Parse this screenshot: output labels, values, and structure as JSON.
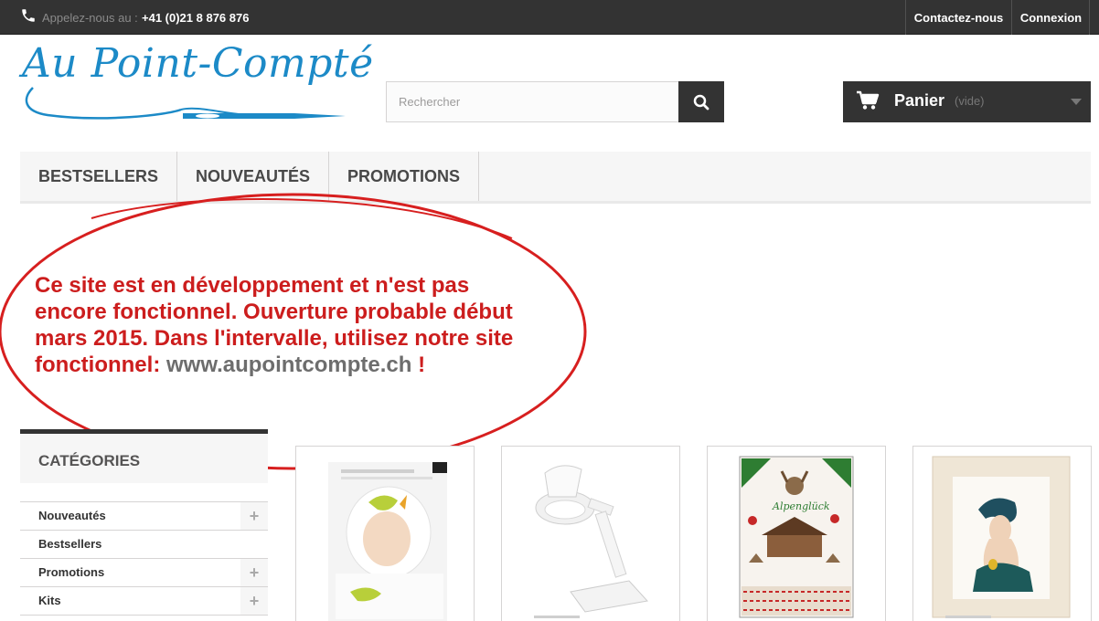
{
  "topbar": {
    "call_label": "Appelez-nous au :",
    "call_number": "+41 (0)21 8 876 876",
    "contact_label": "Contactez-nous",
    "login_label": "Connexion"
  },
  "header": {
    "logo_text": "Au Point-Compté",
    "search_placeholder": "Rechercher",
    "cart_label": "Panier",
    "cart_status": "(vide)"
  },
  "menu": {
    "items": [
      {
        "label": "BESTSELLERS"
      },
      {
        "label": "NOUVEAUTÉS"
      },
      {
        "label": "PROMOTIONS"
      }
    ]
  },
  "notice": {
    "text": "Ce site est en développement et n'est pas encore fonctionnel. Ouverture probable début mars 2015. Dans l'intervalle, utilisez notre site fonctionnel: ",
    "url": "www.aupointcompte.ch",
    "end": " !"
  },
  "categories": {
    "title": "CATÉGORIES",
    "items": [
      {
        "label": "Nouveautés",
        "expandable": true
      },
      {
        "label": "Bestsellers",
        "expandable": false
      },
      {
        "label": "Promotions",
        "expandable": true
      },
      {
        "label": "Kits",
        "expandable": true
      }
    ]
  },
  "colors": {
    "dark": "#333333",
    "brand_blue": "#1c8ac7",
    "notice_red": "#cc1d1d"
  }
}
